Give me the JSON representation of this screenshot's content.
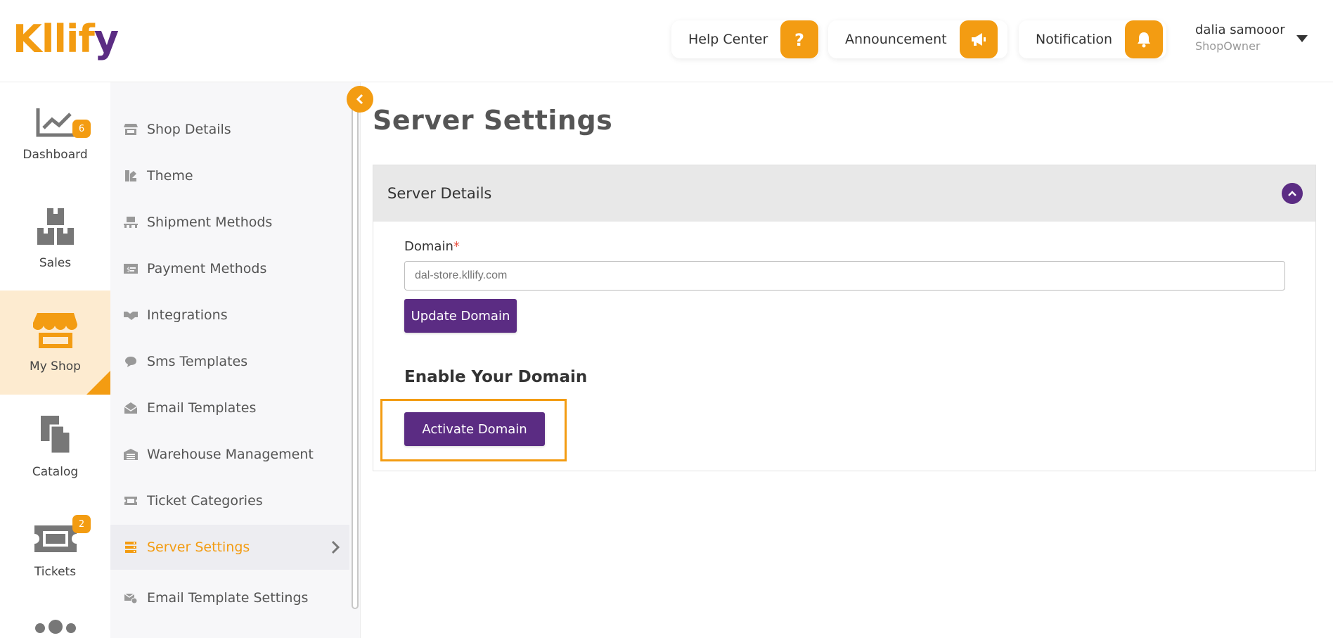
{
  "brand": {
    "logo_main": "Kllif",
    "logo_accent": "y",
    "colors": {
      "primary": "#f39c12",
      "secondary": "#5b2c83"
    }
  },
  "header": {
    "help_center": "Help Center",
    "announcement": "Announcement",
    "notification": "Notification",
    "user": {
      "name": "dalia samooor",
      "role": "ShopOwner"
    }
  },
  "rail": {
    "items": [
      {
        "label": "Dashboard",
        "icon": "chart-line-icon"
      },
      {
        "label": "Sales",
        "icon": "boxes-icon",
        "badge": "6"
      },
      {
        "label": "My Shop",
        "icon": "store-icon",
        "active": true
      },
      {
        "label": "Catalog",
        "icon": "copy-icon"
      },
      {
        "label": "Tickets",
        "icon": "ticket-icon",
        "badge": "2"
      }
    ]
  },
  "subnav": {
    "items": [
      {
        "label": "Shop Details",
        "icon": "store-small-icon"
      },
      {
        "label": "Theme",
        "icon": "palette-icon"
      },
      {
        "label": "Shipment Methods",
        "icon": "pallet-icon"
      },
      {
        "label": "Payment Methods",
        "icon": "money-check-icon"
      },
      {
        "label": "Integrations",
        "icon": "handshake-icon"
      },
      {
        "label": "Sms Templates",
        "icon": "sms-icon"
      },
      {
        "label": "Email Templates",
        "icon": "envelope-open-icon"
      },
      {
        "label": "Warehouse Management",
        "icon": "warehouse-icon"
      },
      {
        "label": "Ticket Categories",
        "icon": "ticket-small-icon"
      },
      {
        "label": "Server Settings",
        "icon": "server-icon",
        "active": true
      },
      {
        "label": "Email Template Settings",
        "icon": "mail-settings-icon"
      }
    ]
  },
  "main": {
    "title": "Server Settings",
    "card": {
      "title": "Server Details",
      "domain_label": "Domain",
      "required_mark": "*",
      "domain_placeholder": "dal-store.kllify.com",
      "update_button": "Update Domain",
      "enable_title": "Enable Your Domain",
      "activate_button": "Activate Domain"
    }
  }
}
